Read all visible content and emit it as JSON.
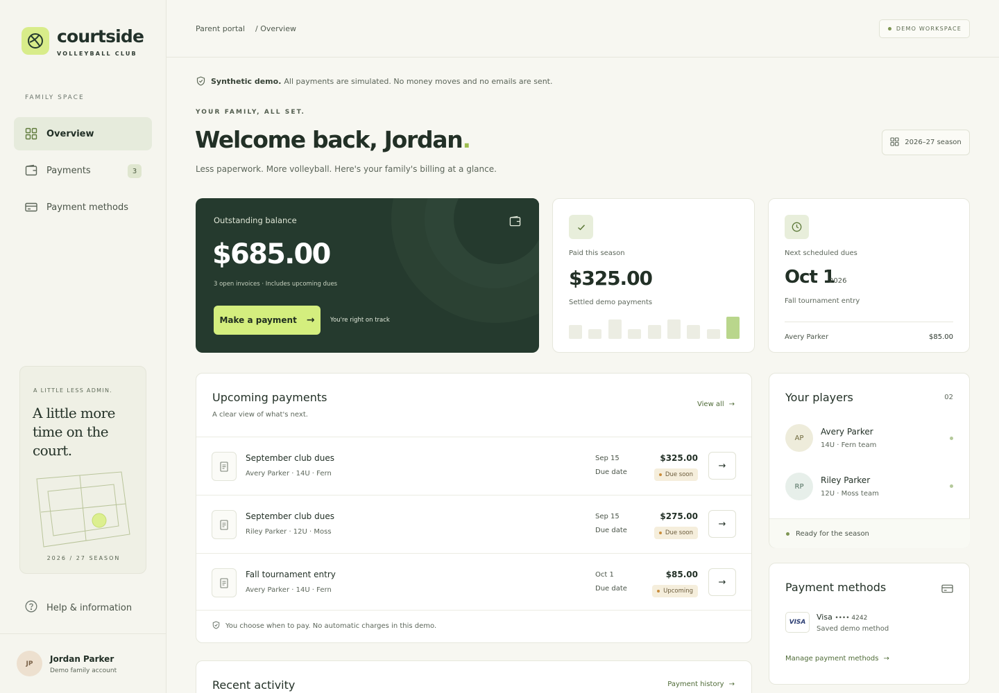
{
  "brand": {
    "name": "courtside",
    "sub": "VOLLEYBALL CLUB"
  },
  "sidebar": {
    "section_label": "FAMILY SPACE",
    "items": [
      {
        "label": "Overview",
        "icon": "grid-icon",
        "active": true
      },
      {
        "label": "Payments",
        "icon": "wallet-icon",
        "badge": "3"
      },
      {
        "label": "Payment methods",
        "icon": "card-icon"
      }
    ],
    "promo": {
      "kicker": "A LITTLE LESS ADMIN.",
      "title": "A little more time on the court.",
      "season": "2026 / 27 SEASON"
    },
    "help_label": "Help & information",
    "user": {
      "initials": "JP",
      "name": "Jordan Parker",
      "role": "Demo family account"
    }
  },
  "topbar": {
    "breadcrumb": [
      "Parent portal",
      "/ Overview"
    ],
    "workspace_badge": "DEMO WORKSPACE"
  },
  "notice": {
    "bold": "Synthetic demo.",
    "text": "All payments are simulated. No money moves and no emails are sent."
  },
  "hero": {
    "kicker": "YOUR FAMILY, ALL SET.",
    "welcome": "Welcome back, Jordan",
    "accent": ".",
    "tagline": "Less paperwork. More volleyball. Here's your family's billing at a glance.",
    "season_button": "2026–27 season"
  },
  "balance": {
    "label": "Outstanding balance",
    "amount": "$685.00",
    "sub": "3 open invoices · Includes upcoming dues",
    "button": "Make a payment",
    "track": "You're right on track"
  },
  "paid": {
    "label": "Paid this season",
    "amount": "$325.00",
    "sub": "Settled demo payments",
    "bar_levels": [
      0.58,
      0.42,
      0.82,
      0.42,
      0.58,
      0.82,
      0.58,
      0.42,
      0.94
    ]
  },
  "next": {
    "label": "Next scheduled dues",
    "date": "Oct 1",
    "year": "2026",
    "sub": "Fall tournament entry",
    "player": "Avery Parker",
    "amount": "$85.00"
  },
  "upcoming": {
    "title": "Upcoming payments",
    "subtitle": "A clear view of what's next.",
    "view_all": "View all",
    "rows": [
      {
        "title": "September club dues",
        "meta": "Avery Parker · 14U · Fern",
        "date": "Sep 15",
        "due": "Due date",
        "amount": "$325.00",
        "status": "Due soon"
      },
      {
        "title": "September club dues",
        "meta": "Riley Parker · 12U · Moss",
        "date": "Sep 15",
        "due": "Due date",
        "amount": "$275.00",
        "status": "Due soon"
      },
      {
        "title": "Fall tournament entry",
        "meta": "Avery Parker · 14U · Fern",
        "date": "Oct 1",
        "due": "Due date",
        "amount": "$85.00",
        "status": "Upcoming"
      }
    ],
    "footer": "You choose when to pay. No automatic charges in this demo."
  },
  "recent": {
    "title": "Recent activity",
    "link": "Payment history"
  },
  "players": {
    "title": "Your players",
    "count": "02",
    "list": [
      {
        "initials": "AP",
        "name": "Avery Parker",
        "team": "14U · Fern team"
      },
      {
        "initials": "RP",
        "name": "Riley Parker",
        "team": "12U · Moss team"
      }
    ],
    "footer": "Ready for the season"
  },
  "payment_methods": {
    "title": "Payment methods",
    "brand": "VISA",
    "name": "Visa",
    "digits": "•••• 4242",
    "sub": "Saved demo method",
    "manage": "Manage payment methods"
  },
  "colors": {
    "accent_green": "#d4ee7e",
    "dark_card": "#253a2e",
    "status_badge": "#f5eedc"
  }
}
